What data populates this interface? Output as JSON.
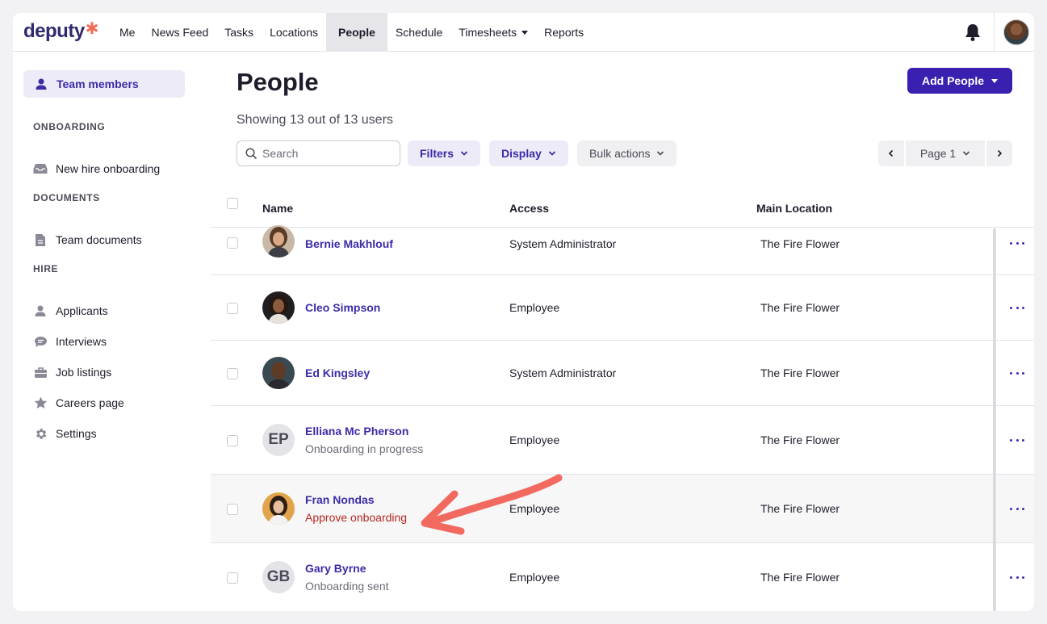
{
  "brand": {
    "logo_text": "deputy",
    "logo_mark": "✱",
    "accent": "#3b1fb0",
    "logo_mark_color": "#ef6e5a"
  },
  "nav": {
    "items": [
      {
        "label": "Me"
      },
      {
        "label": "News Feed"
      },
      {
        "label": "Tasks"
      },
      {
        "label": "Locations"
      },
      {
        "label": "People",
        "active": true
      },
      {
        "label": "Schedule"
      },
      {
        "label": "Timesheets",
        "dropdown": true
      },
      {
        "label": "Reports"
      }
    ],
    "icons": [
      "bell-icon",
      "user-avatar"
    ]
  },
  "sidebar": {
    "active_item": {
      "label": "Team members",
      "icon": "person-icon"
    },
    "sections": [
      {
        "heading": "ONBOARDING",
        "items": [
          {
            "label": "New hire onboarding",
            "icon": "inbox-icon"
          }
        ]
      },
      {
        "heading": "DOCUMENTS",
        "items": [
          {
            "label": "Team documents",
            "icon": "document-icon"
          }
        ]
      },
      {
        "heading": "HIRE",
        "items": [
          {
            "label": "Applicants",
            "icon": "person-icon"
          },
          {
            "label": "Interviews",
            "icon": "chat-icon"
          },
          {
            "label": "Job listings",
            "icon": "briefcase-icon"
          },
          {
            "label": "Careers page",
            "icon": "star-icon"
          },
          {
            "label": "Settings",
            "icon": "gear-icon"
          }
        ]
      }
    ]
  },
  "main": {
    "title": "People",
    "add_button": "Add People",
    "showing": "Showing 13 out of 13 users",
    "search_placeholder": "Search",
    "filters_label": "Filters",
    "display_label": "Display",
    "bulk_label": "Bulk actions",
    "page_label": "Page 1"
  },
  "table": {
    "columns": [
      "Name",
      "Access",
      "Main Location"
    ],
    "rows": [
      {
        "name": "Bernie Makhlouf",
        "sub": "",
        "access": "System Administrator",
        "location": "The Fire Flower",
        "avatar": "photo"
      },
      {
        "name": "Cleo Simpson",
        "sub": "",
        "access": "Employee",
        "location": "The Fire Flower",
        "avatar": "photo"
      },
      {
        "name": "Ed Kingsley",
        "sub": "",
        "access": "System Administrator",
        "location": "The Fire Flower",
        "avatar": "photo"
      },
      {
        "name": "Elliana Mc Pherson",
        "sub": "Onboarding in progress",
        "access": "Employee",
        "location": "The Fire Flower",
        "avatar": "EP"
      },
      {
        "name": "Fran Nondas",
        "sub": "Approve onboarding",
        "access": "Employee",
        "location": "The Fire Flower",
        "avatar": "photo",
        "highlighted": true
      },
      {
        "name": "Gary Byrne",
        "sub": "Onboarding sent",
        "access": "Employee",
        "location": "The Fire Flower",
        "avatar": "GB"
      }
    ]
  }
}
